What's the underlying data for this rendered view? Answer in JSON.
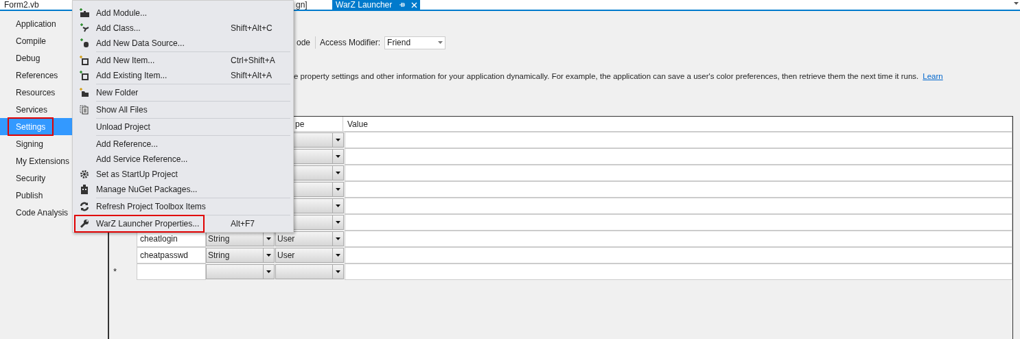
{
  "tabs": [
    {
      "label": "Form2.vb",
      "selected": false
    },
    {
      "label": "gn]",
      "selected": false
    },
    {
      "label": "WarZ Launcher",
      "selected": true
    }
  ],
  "sidebar": {
    "items": [
      {
        "label": "Application",
        "selected": false,
        "annotated": false
      },
      {
        "label": "Compile",
        "selected": false,
        "annotated": false
      },
      {
        "label": "Debug",
        "selected": false,
        "annotated": false
      },
      {
        "label": "References",
        "selected": false,
        "annotated": false
      },
      {
        "label": "Resources",
        "selected": false,
        "annotated": false
      },
      {
        "label": "Services",
        "selected": false,
        "annotated": false
      },
      {
        "label": "Settings",
        "selected": true,
        "annotated": true
      },
      {
        "label": "Signing",
        "selected": false,
        "annotated": false
      },
      {
        "label": "My Extensions",
        "selected": false,
        "annotated": false
      },
      {
        "label": "Security",
        "selected": false,
        "annotated": false
      },
      {
        "label": "Publish",
        "selected": false,
        "annotated": false
      },
      {
        "label": "Code Analysis",
        "selected": false,
        "annotated": false
      }
    ]
  },
  "toolbar": {
    "partial_label": "ode",
    "access_modifier_label": "Access Modifier:",
    "access_modifier_value": "Friend"
  },
  "description": "e property settings and other information for your application dynamically. For example, the application can save a user's color preferences, then retrieve them the next time it runs.",
  "learn_link": "Learn",
  "grid": {
    "columns": [
      "pe",
      "Value"
    ],
    "rows": [
      {},
      {},
      {},
      {},
      {},
      {},
      {
        "name": "cheatlogin",
        "type": "String",
        "scope": "User"
      },
      {
        "name": "cheatpasswd",
        "type": "String",
        "scope": "User"
      },
      {
        "new_row_marker": "*"
      }
    ]
  },
  "context_menu": {
    "items": [
      {
        "kind": "item",
        "label": "Add Module...",
        "annotated": false
      },
      {
        "kind": "item",
        "label": "Add Class...",
        "shortcut": "Shift+Alt+C",
        "annotated": false
      },
      {
        "kind": "item",
        "label": "Add New Data Source...",
        "annotated": false
      },
      {
        "kind": "separator"
      },
      {
        "kind": "item",
        "label": "Add New Item...",
        "shortcut": "Ctrl+Shift+A",
        "annotated": false
      },
      {
        "kind": "item",
        "label": "Add Existing Item...",
        "shortcut": "Shift+Alt+A",
        "annotated": false
      },
      {
        "kind": "separator"
      },
      {
        "kind": "item",
        "label": "New Folder",
        "annotated": false
      },
      {
        "kind": "separator"
      },
      {
        "kind": "item",
        "label": "Show All Files",
        "annotated": false
      },
      {
        "kind": "separator"
      },
      {
        "kind": "item",
        "label": "Unload Project",
        "annotated": false
      },
      {
        "kind": "separator"
      },
      {
        "kind": "item",
        "label": "Add Reference...",
        "annotated": false
      },
      {
        "kind": "item",
        "label": "Add Service Reference...",
        "annotated": false
      },
      {
        "kind": "item",
        "label": "Set as StartUp Project",
        "annotated": false
      },
      {
        "kind": "item",
        "label": "Manage NuGet Packages...",
        "annotated": false
      },
      {
        "kind": "separator"
      },
      {
        "kind": "item",
        "label": "Refresh Project Toolbox Items",
        "annotated": false
      },
      {
        "kind": "separator"
      },
      {
        "kind": "item",
        "label": "WarZ Launcher Properties...",
        "shortcut": "Alt+F7",
        "annotated": true
      }
    ]
  }
}
